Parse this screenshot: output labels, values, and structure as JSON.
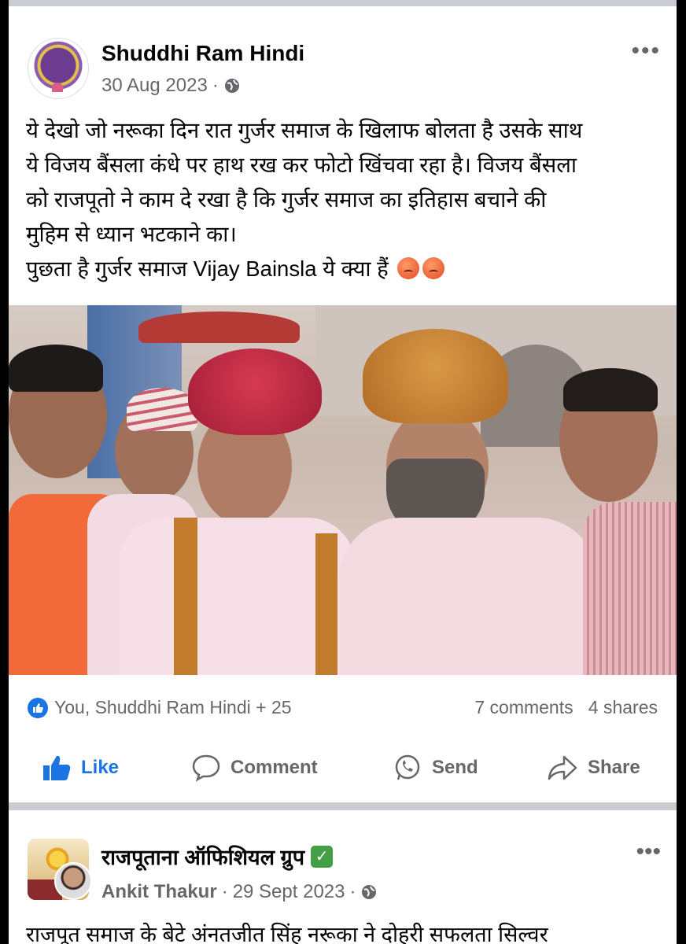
{
  "post1": {
    "author": "Shuddhi Ram Hindi",
    "date": "30 Aug 2023",
    "separator": "·",
    "privacy_icon": "globe-icon",
    "text_lines": [
      "ये देखो जो नरूका दिन रात गुर्जर समाज के खिलाफ बोलता है उसके साथ",
      "ये विजय बैंसला कंधे पर हाथ रख कर फोटो खिंचवा रहा है। विजय बैंसला",
      "को राजपूतो ने काम दे रखा है कि गुर्जर समाज का इतिहास बचाने की",
      "मुहिम से ध्यान भटकाने का।",
      "पुछता है गुर्जर समाज Vijay Bainsla ये क्या हैं"
    ],
    "reactions": "You, Shuddhi Ram Hindi + 25",
    "comments": "7 comments",
    "shares": "4 shares",
    "actions": {
      "like": "Like",
      "comment": "Comment",
      "send": "Send",
      "share": "Share"
    }
  },
  "post2": {
    "group": "राजपूताना ऑफिशियल ग्रुप",
    "author": "Ankit Thakur",
    "date": "29 Sept 2023",
    "separator": "·",
    "text": "राजपूत समाज के बेटे अंनतजीत सिंह नरूका ने दोहरी सफलता सिल्वर"
  },
  "colors": {
    "accent": "#1b74e4",
    "muted": "#65676b",
    "verified": "#43a047"
  }
}
